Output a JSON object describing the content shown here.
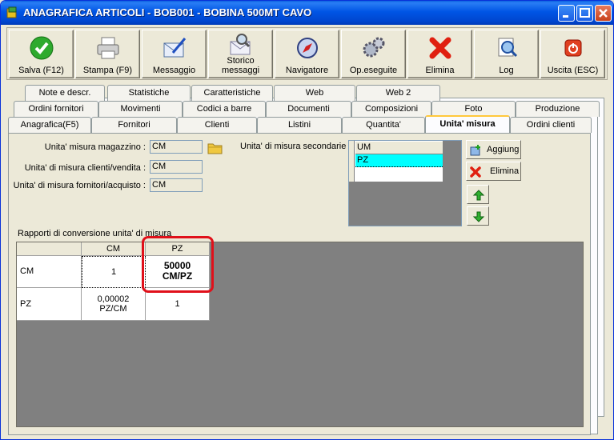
{
  "window": {
    "title": "ANAGRAFICA ARTICOLI - BOB001 - BOBINA 500MT CAVO"
  },
  "toolbar": {
    "buttons": [
      {
        "label": "Salva (F12)",
        "icon": "check-icon"
      },
      {
        "label": "Stampa (F9)",
        "icon": "printer-icon"
      },
      {
        "label": "Messaggio",
        "icon": "pen-envelope-icon"
      },
      {
        "label_line1": "Storico",
        "label_line2": "messaggi",
        "icon": "search-envelope-icon"
      },
      {
        "label": "Navigatore",
        "icon": "compass-icon"
      },
      {
        "label": "Op.eseguite",
        "icon": "gears-icon"
      },
      {
        "label": "Elimina",
        "icon": "red-x-icon"
      },
      {
        "label": "Log",
        "icon": "log-search-icon"
      },
      {
        "label": "Uscita (ESC)",
        "icon": "exit-icon"
      }
    ]
  },
  "tabs": {
    "row1": [
      "Note e descr.",
      "Statistiche",
      "Caratteristiche",
      "Web",
      "Web 2"
    ],
    "row2": [
      "Ordini fornitori",
      "Movimenti",
      "Codici a barre",
      "Documenti",
      "Composizioni",
      "Foto",
      "Produzione"
    ],
    "row3": [
      "Anagrafica(F5)",
      "Fornitori",
      "Clienti",
      "Listini",
      "Quantita'",
      "Unita' misura",
      "Ordini clienti"
    ],
    "active": "Unita' misura"
  },
  "form": {
    "warehouse_label": "Unita' misura magazzino :",
    "warehouse_value": "CM",
    "sales_label": "Unita' di misura clienti/vendita :",
    "sales_value": "CM",
    "purchase_label": "Unita' di misura fornitori/acquisto :",
    "purchase_value": "CM",
    "secondary_label": "Unita' di misura secondarie :",
    "secondary_header": "UM",
    "secondary_items": [
      "PZ"
    ],
    "add_label": "Aggiung",
    "delete_label": "Elimina"
  },
  "conversion": {
    "label": "Rapporti di conversione unita' di misura",
    "columns": [
      "CM",
      "PZ"
    ],
    "rows": [
      {
        "name": "CM",
        "cells": [
          "1",
          "50000 CM/PZ"
        ]
      },
      {
        "name": "PZ",
        "cells": [
          "0,00002 PZ/CM",
          "1"
        ]
      }
    ],
    "cm_pz_line1": "50000",
    "cm_pz_line2": "CM/PZ",
    "pz_cm_line1": "0,00002",
    "pz_cm_line2": "PZ/CM"
  },
  "colors": {
    "selection": "#00ffff",
    "highlight": "#e0101a",
    "title_bar": "#0055e5"
  }
}
